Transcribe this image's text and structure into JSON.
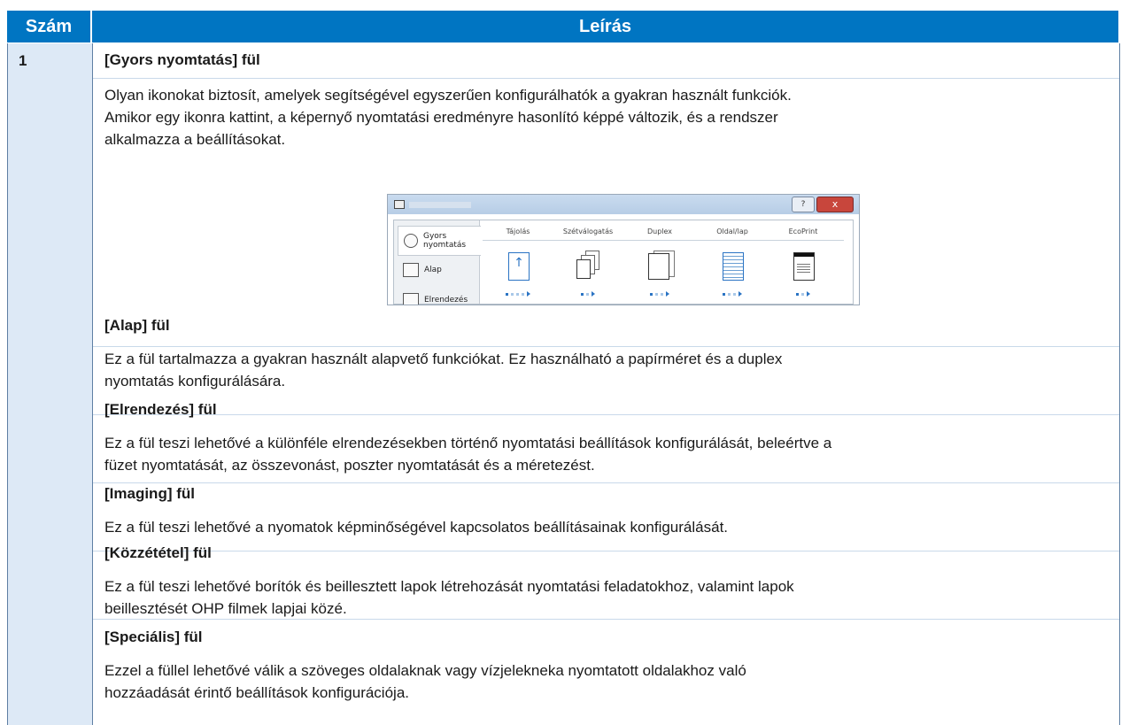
{
  "table": {
    "header": {
      "num": "Szám",
      "desc": "Leírás"
    },
    "row_num": "1"
  },
  "sections": [
    {
      "heading": "[Gyors nyomtatás] fül",
      "lines": [
        "Olyan ikonokat biztosít, amelyek segítségével egyszerűen konfigurálhatók a gyakran használt funkciók.",
        "Amikor egy ikonra kattint, a képernyő nyomtatási eredményre hasonlító képpé változik, és a rendszer",
        "alkalmazza a beállításokat."
      ]
    },
    {
      "heading": "[Alap] fül",
      "lines": [
        "Ez a fül tartalmazza a gyakran használt alapvető funkciókat. Ez használható a papírméret és a duplex",
        "nyomtatás konfigurálására."
      ]
    },
    {
      "heading": "[Elrendezés] fül",
      "lines": [
        "Ez a fül teszi lehetővé a különféle elrendezésekben történő nyomtatási beállítások konfigurálását, beleértve a",
        "füzet nyomtatását, az összevonást, poszter nyomtatását és a méretezést."
      ]
    },
    {
      "heading": "[Imaging] fül",
      "lines": [
        "Ez a fül teszi lehetővé a nyomatok képminőségével kapcsolatos beállításainak konfigurálását."
      ]
    },
    {
      "heading": "[Közzététel] fül",
      "lines": [
        "Ez a fül teszi lehetővé borítók és beillesztett lapok létrehozását nyomtatási feladatokhoz, valamint lapok",
        "beillesztését OHP filmek lapjai közé."
      ]
    },
    {
      "heading": "[Speciális] fül",
      "lines": [
        "Ezzel a füllel lehetővé válik a szöveges oldalaknak vagy vízjelekneka nyomtatott oldalakhoz való",
        "hozzáadását érintő beállítások konfigurációja."
      ]
    }
  ],
  "screenshot": {
    "help_btn": "?",
    "close_btn": "x",
    "side_tabs": [
      {
        "label_1": "Gyors",
        "label_2": "nyomtatás",
        "icon": "quick-print-icon"
      },
      {
        "label_1": "Alap",
        "label_2": "",
        "icon": "basic-icon"
      },
      {
        "label_1": "Elrendezés",
        "label_2": "",
        "icon": "layout-icon"
      }
    ],
    "quick_print_labels": [
      "Tájolás",
      "Szétválogatás",
      "Duplex",
      "Oldal/lap",
      "EcoPrint"
    ],
    "arrow_glyph": "↑"
  }
}
